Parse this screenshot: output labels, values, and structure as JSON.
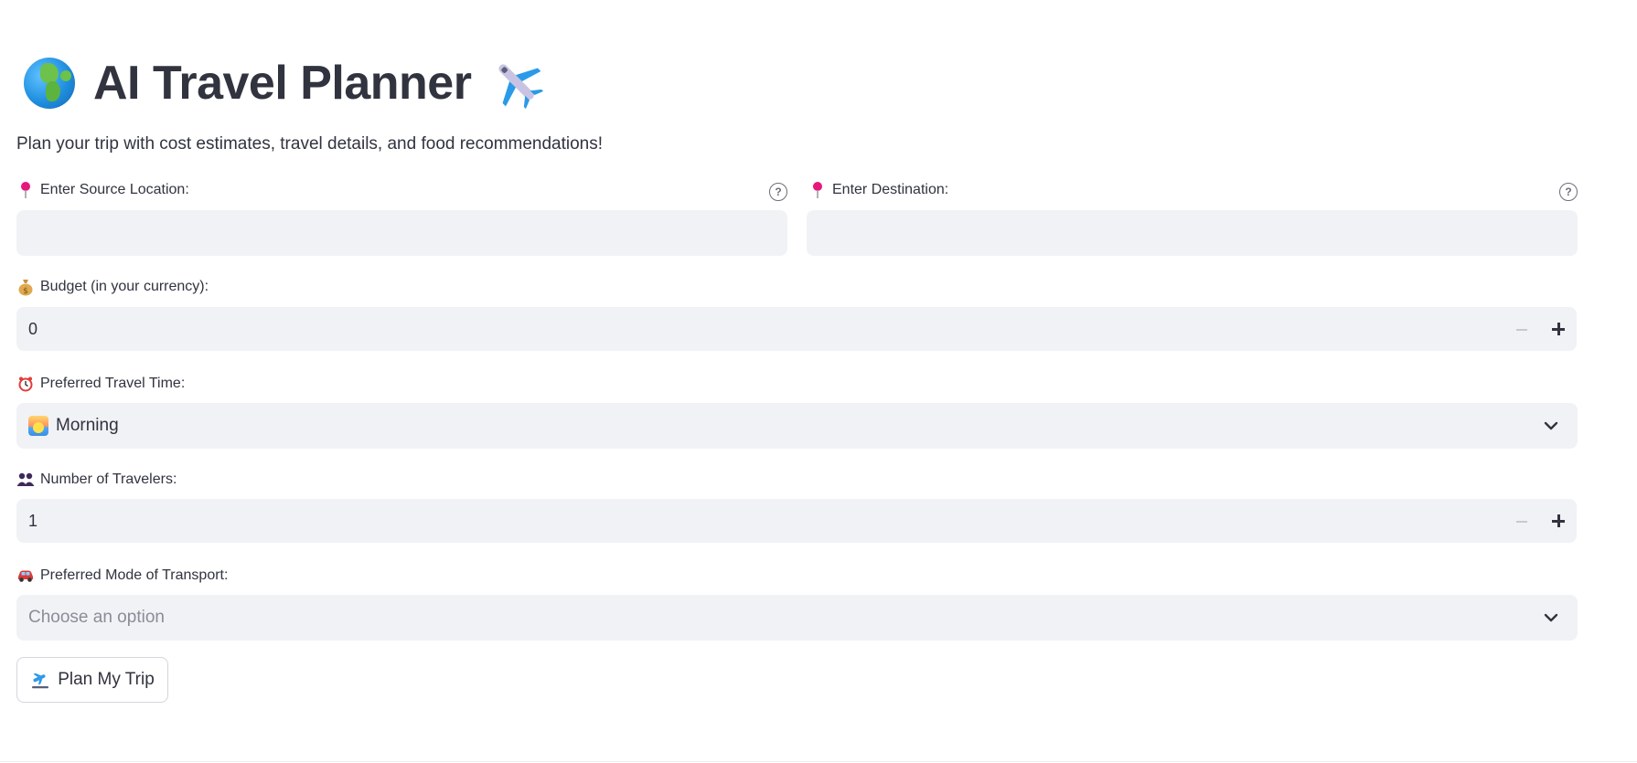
{
  "header": {
    "title": "AI Travel Planner",
    "title_left_icon": "globe-emoji-icon",
    "title_right_icon": "airplane-emoji-icon",
    "subtitle": "Plan your trip with cost estimates, travel details, and food recommendations!"
  },
  "source": {
    "label": "Enter Source Location:",
    "icon": "pushpin-icon",
    "value": "",
    "help_icon": "question-circle-icon"
  },
  "destination": {
    "label": "Enter Destination:",
    "icon": "pushpin-icon",
    "value": "",
    "help_icon": "question-circle-icon"
  },
  "budget": {
    "label": "Budget (in your currency):",
    "icon": "money-bag-icon",
    "value": "0"
  },
  "travel_time": {
    "label": "Preferred Travel Time:",
    "icon": "alarm-clock-icon",
    "selected": "Morning",
    "selected_icon": "sunrise-icon"
  },
  "travelers": {
    "label": "Number of Travelers:",
    "icon": "people-icon",
    "value": "1"
  },
  "transport": {
    "label": "Preferred Mode of Transport:",
    "icon": "car-icon",
    "placeholder": "Choose an option"
  },
  "plan_button": {
    "label": "Plan My Trip",
    "icon": "airplane-departure-icon"
  },
  "colors": {
    "input_bg": "#f0f2f6",
    "text": "#31333f",
    "placeholder": "#8a8d96"
  }
}
